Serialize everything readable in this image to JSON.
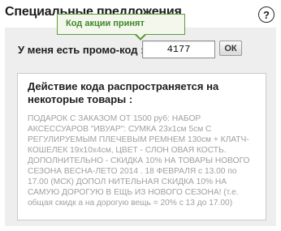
{
  "header": {
    "title": "Специальные предложения",
    "help_label": "?"
  },
  "tooltip": {
    "text": "Код акции принят"
  },
  "promo": {
    "label": "У меня есть промо-код :",
    "code_value": "4177",
    "ok_label": "ОК"
  },
  "details": {
    "heading": "Действие кода распространяется на некоторые товары :",
    "description": "ПОДАРОК С ЗАКАЗОМ ОТ 1500 руб: НАБОР АКСЕССУАРОВ \"ИВУАР\": СУМКА 23х1см 5см С РЕГУЛИРУЕМЫМ ПЛЕЧЕВЫМ РЕМНЕМ 130см + КЛАТЧ-КОШЕЛЕК 19х10х4см, ЦВЕТ - СЛОН ОВАЯ КОСТЬ. ДОПОЛНИТЕЛЬНО - СКИДКА 10% НА ТОВАРЫ НОВОГО СЕЗОНА ВЕСНА-ЛЕТО 2014 . 18 ФЕВРАЛЯ с 13.00 по 17.00 (МСК) ДОПОЛ НИТЕЛЬНАЯ СКИДКА 10% НА САМУЮ ДОРОГУЮ В ЕЩЬ ИЗ НОВОГО СЕЗОНА! (т.е. общая скидк а на дорогую вещь = 20% с 13 до 17.00)"
  },
  "colors": {
    "panel_background": "#eeeeee",
    "tooltip_border": "#5a9f3c",
    "tooltip_text": "#3d8a2a",
    "description_text": "#a0a0a0"
  }
}
